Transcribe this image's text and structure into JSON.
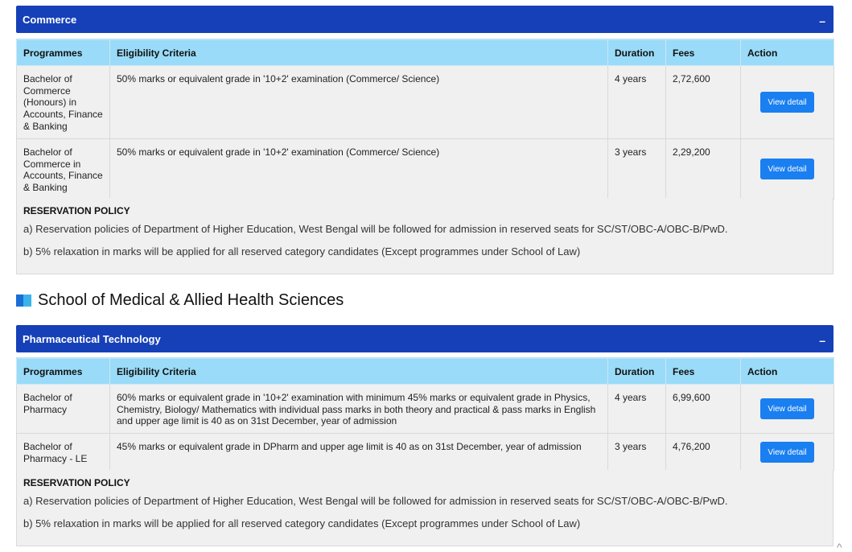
{
  "sections": [
    {
      "accordion_title": "Commerce",
      "toggle": "–",
      "headers": [
        "Programmes",
        "Eligibility Criteria",
        "Duration",
        "Fees",
        "Action"
      ],
      "rows": [
        {
          "programme": "Bachelor of Commerce (Honours) in Accounts, Finance & Banking",
          "eligibility": "50% marks or equivalent grade in '10+2' examination (Commerce/ Science)",
          "duration": "4 years",
          "fees": "2,72,600",
          "action": "View detail"
        },
        {
          "programme": "Bachelor of Commerce in Accounts, Finance & Banking",
          "eligibility": "50% marks or equivalent grade in '10+2' examination (Commerce/ Science)",
          "duration": "3 years",
          "fees": "2,29,200",
          "action": "View detail"
        }
      ],
      "policy": {
        "title": "RESERVATION POLICY",
        "lines": [
          "a) Reservation policies of Department of Higher Education, West Bengal will be followed for admission in reserved seats for SC/ST/OBC-A/OBC-B/PwD.",
          "b) 5% relaxation in marks will be applied for all reserved category candidates (Except programmes under School of Law)"
        ]
      }
    },
    {
      "accordion_title": "Pharmaceutical Technology",
      "toggle": "–",
      "headers": [
        "Programmes",
        "Eligibility Criteria",
        "Duration",
        "Fees",
        "Action"
      ],
      "rows": [
        {
          "programme": "Bachelor of Pharmacy",
          "eligibility": "60% marks or equivalent grade in '10+2' examination with minimum 45% marks or equivalent grade in Physics, Chemistry, Biology/ Mathematics with individual pass marks in both theory and practical & pass marks in English and upper age limit is 40 as on 31st December, year of admission",
          "duration": "4 years",
          "fees": "6,99,600",
          "action": "View detail"
        },
        {
          "programme": "Bachelor of Pharmacy - LE",
          "eligibility": "45% marks or equivalent grade in DPharm and upper age limit is 40 as on 31st December, year of admission",
          "duration": "3 years",
          "fees": "4,76,200",
          "action": "View detail"
        }
      ],
      "policy": {
        "title": "RESERVATION POLICY",
        "lines": [
          "a) Reservation policies of Department of Higher Education, West Bengal will be followed for admission in reserved seats for SC/ST/OBC-A/OBC-B/PwD.",
          "b) 5% relaxation in marks will be applied for all reserved category candidates (Except programmes under School of Law)"
        ]
      }
    }
  ],
  "school_heading": "School of Medical & Allied Health Sciences",
  "scroll_top": "^",
  "colors": {
    "accordion_bg": "#1640b8",
    "table_header_bg": "#99dbf8",
    "button_bg": "#1a7ff0",
    "cell_bg": "#f0f0f0"
  }
}
